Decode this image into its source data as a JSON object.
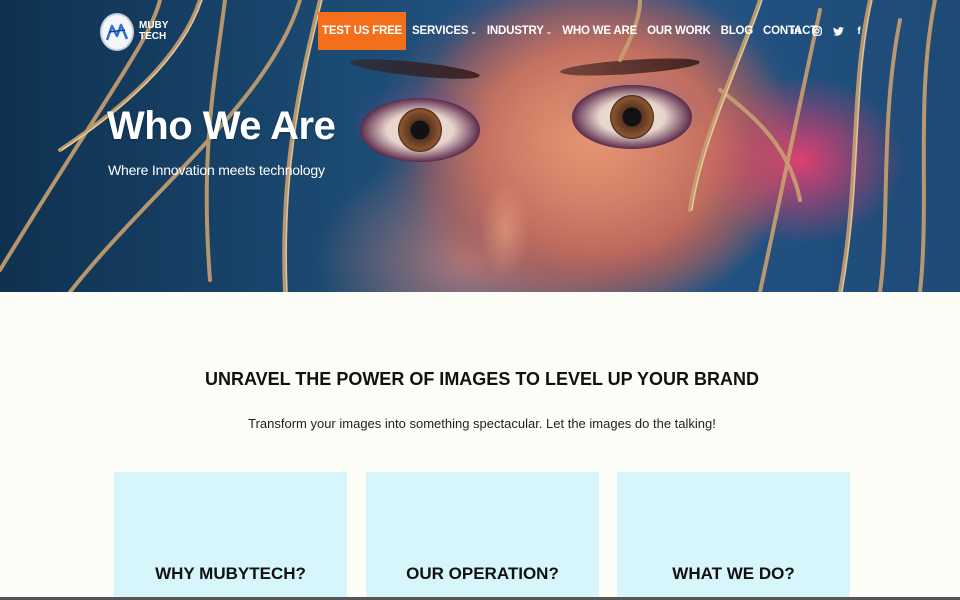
{
  "brand": {
    "logo_line1": "MUBY",
    "logo_line2": "TECH"
  },
  "nav": {
    "items": [
      {
        "label": "TEST US FREE",
        "cta": true
      },
      {
        "label": "SERVICES",
        "has_dropdown": true
      },
      {
        "label": "INDUSTRY",
        "has_dropdown": true
      },
      {
        "label": "WHO WE ARE"
      },
      {
        "label": "OUR WORK"
      },
      {
        "label": "BLOG"
      },
      {
        "label": "CONTACT"
      }
    ],
    "dropdown_icon": "chevron-down-icon"
  },
  "social": {
    "icons": [
      "linkedin-icon",
      "instagram-icon",
      "twitter-icon",
      "facebook-icon"
    ],
    "linkedin": "in",
    "facebook": "f"
  },
  "hero": {
    "title": "Who We Are",
    "subtitle": "Where Innovation meets technology"
  },
  "main": {
    "headline": "UNRAVEL THE POWER OF IMAGES TO LEVEL UP YOUR BRAND",
    "subline": "Transform your images into something spectacular. Let the images do the talking!",
    "cards": [
      {
        "title": "WHY MUBYTECH?"
      },
      {
        "title": "OUR OPERATION?"
      },
      {
        "title": "WHAT WE DO?"
      }
    ]
  },
  "colors": {
    "cta": "#f36f1c",
    "card_bg": "#d6f6fb",
    "page_bg": "#fdfdf8"
  }
}
